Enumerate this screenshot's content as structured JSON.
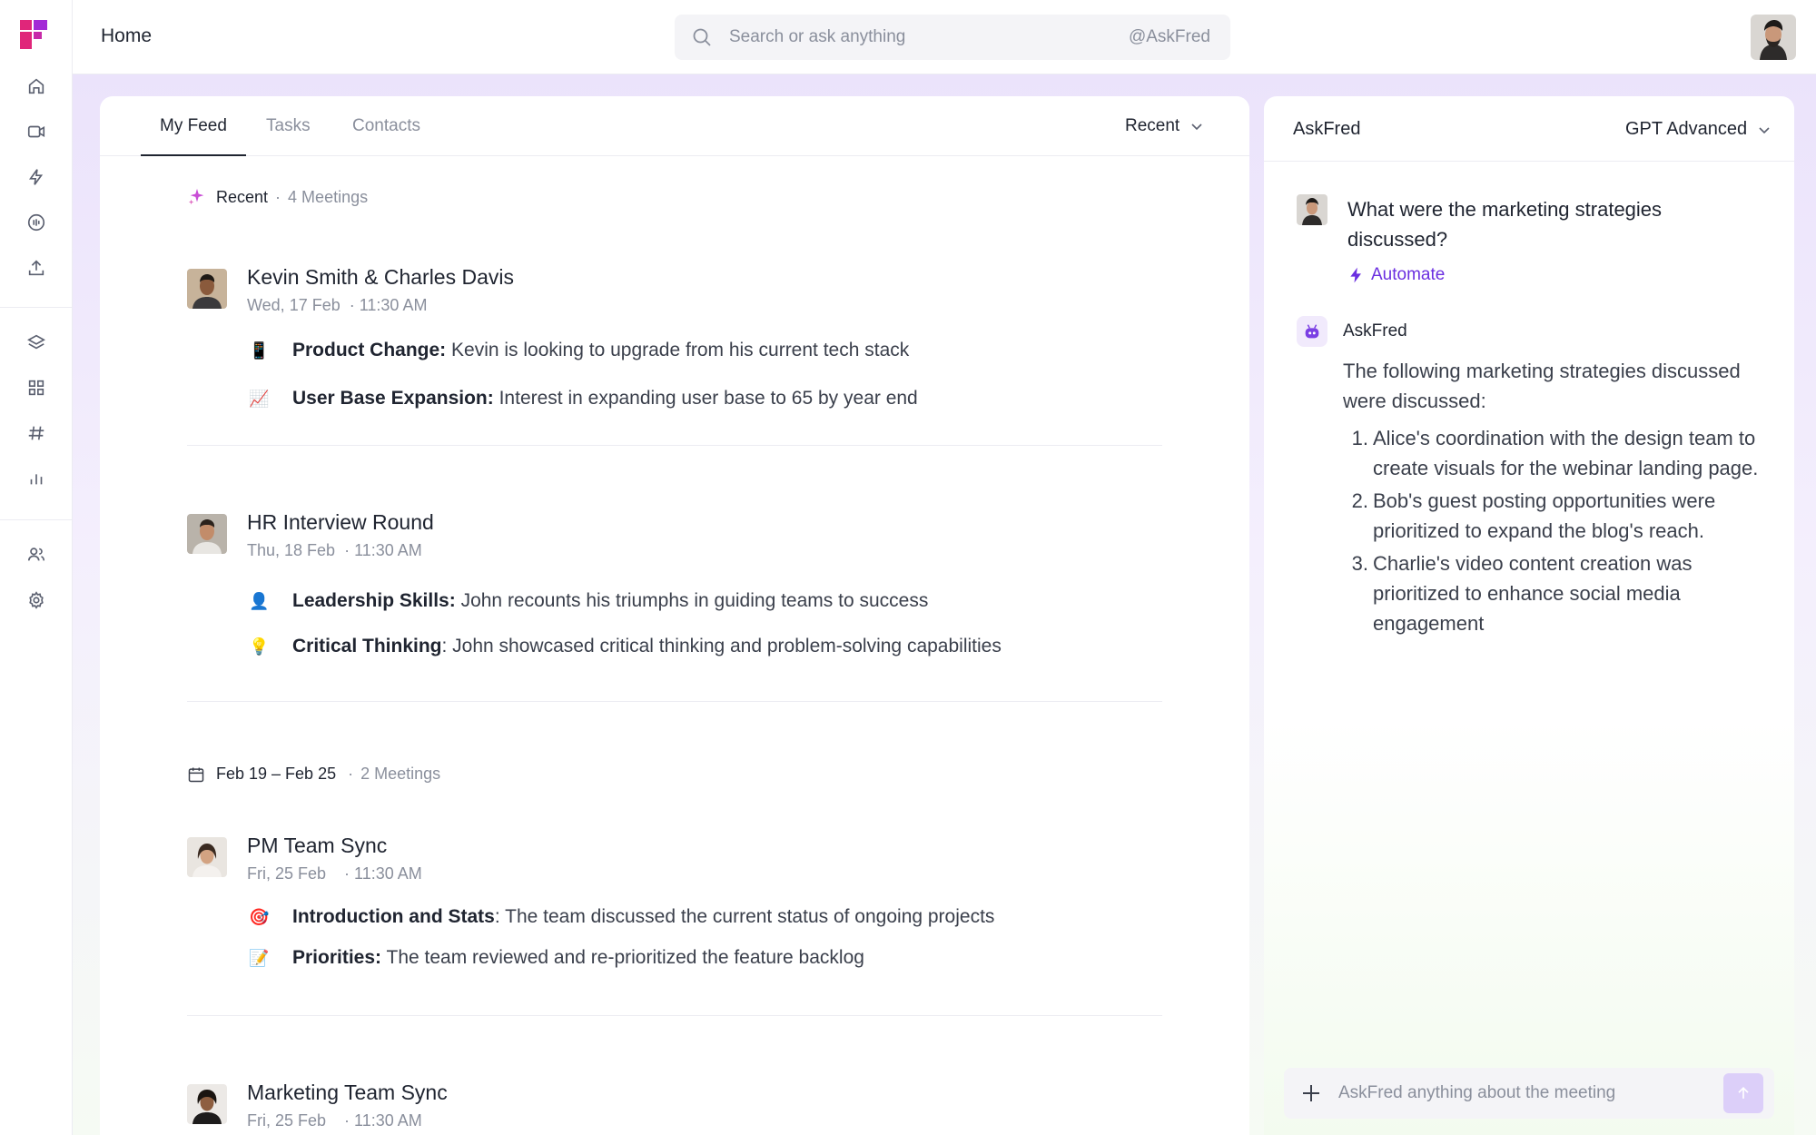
{
  "header": {
    "title": "Home",
    "search_placeholder": "Search or ask anything",
    "search_mention": "@AskFred"
  },
  "feed": {
    "tabs": [
      {
        "label": "My Feed",
        "active": true
      },
      {
        "label": "Tasks",
        "active": false
      },
      {
        "label": "Contacts",
        "active": false
      }
    ],
    "sort_label": "Recent",
    "sections": [
      {
        "icon": "sparkle-icon",
        "label": "Recent",
        "count": "4 Meetings",
        "meetings": [
          {
            "title": "Kevin Smith & Charles Davis",
            "date": "Wed, 17 Feb",
            "time": "11:30 AM",
            "items": [
              {
                "emoji": "📱",
                "label": "Product Change:",
                "text": " Kevin is looking to upgrade from his current tech stack"
              },
              {
                "emoji": "📈",
                "label": "User Base Expansion:",
                "text": " Interest in expanding user base to 65 by year end"
              }
            ]
          },
          {
            "title": "HR Interview Round",
            "date": "Thu, 18 Feb",
            "time": "11:30 AM",
            "items": [
              {
                "emoji": "👤",
                "label": "Leadership Skills:",
                "text": " John recounts his triumphs in guiding teams to success"
              },
              {
                "emoji": "💡",
                "label": "Critical Thinking",
                "text": ": John showcased critical thinking and problem-solving capabilities"
              }
            ]
          }
        ]
      },
      {
        "icon": "calendar-icon",
        "label": "Feb 19 – Feb 25",
        "count": "2 Meetings",
        "meetings": [
          {
            "title": "PM Team Sync",
            "date": "Fri, 25 Feb",
            "time": "11:30 AM",
            "items": [
              {
                "emoji": "🎯",
                "label": "Introduction and Stats",
                "text": ": The team discussed the current status of ongoing projects"
              },
              {
                "emoji": "📝",
                "label": "Priorities:",
                "text": " The team reviewed and re-prioritized the feature backlog"
              }
            ]
          },
          {
            "title": "Marketing Team Sync",
            "date": "Fri, 25 Feb",
            "time": "11:30 AM",
            "items": []
          }
        ]
      }
    ]
  },
  "chat": {
    "title": "AskFred",
    "model": "GPT Advanced",
    "question": "What were the marketing strategies discussed?",
    "automate_label": "Automate",
    "bot_name": "AskFred",
    "answer_intro": "The following marketing strategies discussed were discussed:",
    "answer_items": [
      "Alice's coordination with the design team to create visuals for the webinar landing page.",
      "Bob's guest posting opportunities were prioritized to expand the blog's reach.",
      "Charlie's video content creation was prioritized to enhance social media engagement"
    ],
    "composer_placeholder": "AskFred anything about the meeting"
  },
  "colors": {
    "accent": "#6b2fe0",
    "brand": "#e0267a",
    "canvas": "#ebe3fb"
  }
}
